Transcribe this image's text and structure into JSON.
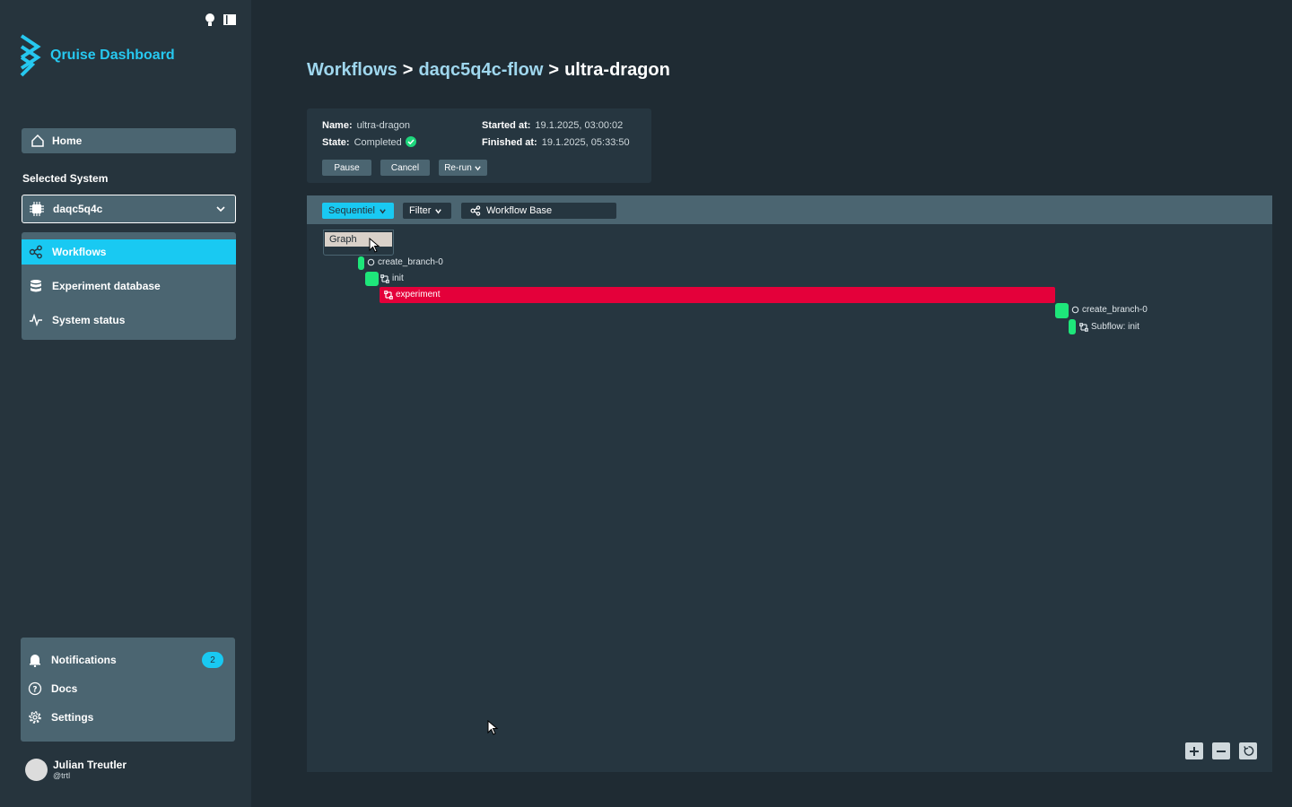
{
  "app": {
    "title": "Qruise Dashboard"
  },
  "sidebar": {
    "home_label": "Home",
    "selected_system_label": "Selected System",
    "system_value": "daqc5q4c",
    "nav": [
      {
        "label": "Workflows",
        "icon": "workflow-icon",
        "active": true
      },
      {
        "label": "Experiment database",
        "icon": "database-icon",
        "active": false
      },
      {
        "label": "System status",
        "icon": "pulse-icon",
        "active": false
      }
    ],
    "bottom": [
      {
        "label": "Notifications",
        "icon": "bell-icon",
        "badge": "2"
      },
      {
        "label": "Docs",
        "icon": "help-icon"
      },
      {
        "label": "Settings",
        "icon": "gear-icon"
      }
    ],
    "user": {
      "name": "Julian Treutler",
      "handle": "@trtl"
    }
  },
  "breadcrumb": {
    "items": [
      "Workflows",
      "daqc5q4c-flow",
      "ultra-dragon"
    ],
    "separator": ">"
  },
  "workflow": {
    "name_label": "Name:",
    "name": "ultra-dragon",
    "state_label": "State:",
    "state": "Completed",
    "started_label": "Started at:",
    "started": "19.1.2025, 03:00:02",
    "finished_label": "Finished at:",
    "finished": "19.1.2025, 05:33:50",
    "buttons": {
      "pause": "Pause",
      "cancel": "Cancel",
      "rerun": "Re-run"
    }
  },
  "toolbar": {
    "view_mode": "Sequentiel",
    "filter_label": "Filter",
    "base_label": "Workflow Base",
    "dropdown_options": [
      "Graph"
    ]
  },
  "timeline": {
    "nodes": [
      {
        "label": "create_branch-0",
        "status": "success",
        "type": "branch"
      },
      {
        "label": "init",
        "status": "success",
        "type": "flow"
      },
      {
        "label": "experiment",
        "status": "failed",
        "type": "flow"
      },
      {
        "label": "create_branch-0",
        "status": "success",
        "type": "branch"
      },
      {
        "label": "Subflow: init",
        "status": "success",
        "type": "flow"
      }
    ]
  },
  "colors": {
    "accent": "#19c9f2",
    "success": "#1ee67a",
    "failed": "#e4003a",
    "panel": "#4b6571",
    "background": "#1f2b33"
  }
}
